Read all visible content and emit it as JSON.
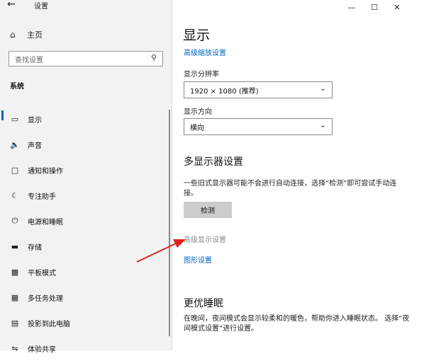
{
  "window": {
    "back_icon": "back-arrow-icon",
    "title": "设置",
    "controls": [
      "minimize-icon",
      "maximize-icon",
      "close-icon"
    ]
  },
  "sidebar": {
    "home_label": "主页",
    "search_placeholder": "查找设置",
    "group_title": "系统",
    "items": [
      {
        "label": "显示",
        "icon": "monitor-icon",
        "active": true
      },
      {
        "label": "声音",
        "icon": "speaker-icon"
      },
      {
        "label": "通知和操作",
        "icon": "notification-icon"
      },
      {
        "label": "专注助手",
        "icon": "moon-icon"
      },
      {
        "label": "电源和睡眠",
        "icon": "power-icon"
      },
      {
        "label": "存储",
        "icon": "storage-icon"
      },
      {
        "label": "平板模式",
        "icon": "tablet-icon"
      },
      {
        "label": "多任务处理",
        "icon": "multitask-icon"
      },
      {
        "label": "投影到此电脑",
        "icon": "project-icon"
      },
      {
        "label": "体验共享",
        "icon": "share-icon"
      }
    ]
  },
  "main": {
    "title": "显示",
    "advanced_scaling_link": "高级缩放设置",
    "resolution": {
      "label": "显示分辨率",
      "value": "1920 × 1080 (推荐)"
    },
    "orientation": {
      "label": "显示方向",
      "value": "横向"
    },
    "multi_display": {
      "heading": "多显示器设置",
      "description": "一些旧式显示器可能不会进行自动连接，选择“检测”即可尝试手动连接。",
      "detect_button": "检测"
    },
    "advanced_display_link": "高级显示设置",
    "graphics_link": "图形设置",
    "sleep": {
      "heading": "更优睡眠",
      "description": "在晚间，夜间模式会显示较柔和的暖色，帮助你进入睡眠状态。 选择“夜间模式设置”进行设置。"
    }
  },
  "colors": {
    "accent": "#0067c0",
    "annotation_arrow": "#e02020"
  }
}
